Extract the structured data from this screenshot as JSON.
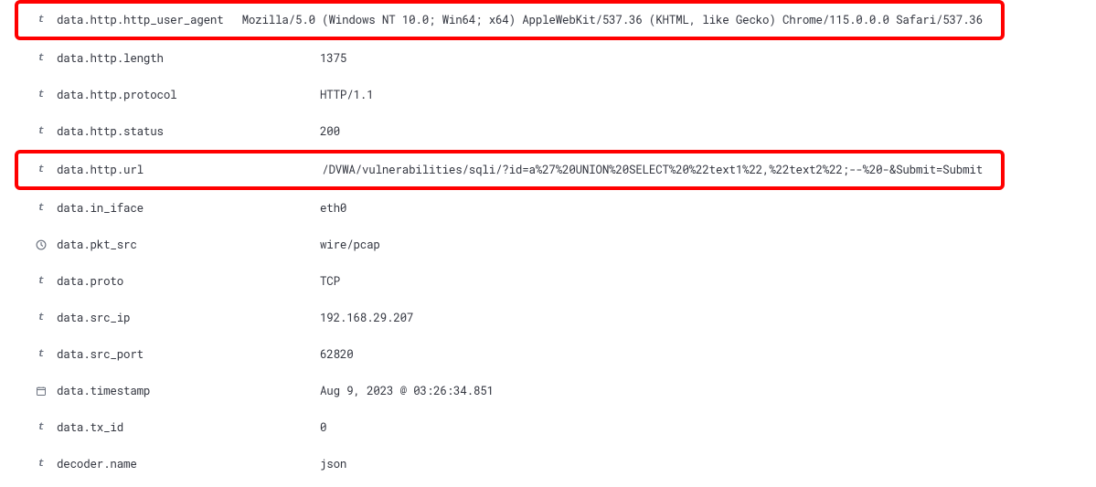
{
  "rows": [
    {
      "icon_type": "text",
      "name": "data.http.http_user_agent",
      "value": "Mozilla/5.0 (Windows NT 10.0; Win64; x64) AppleWebKit/537.36 (KHTML, like Gecko) Chrome/115.0.0.0 Safari/537.36",
      "highlighted": true
    },
    {
      "icon_type": "text",
      "name": "data.http.length",
      "value": "1375",
      "highlighted": false
    },
    {
      "icon_type": "text",
      "name": "data.http.protocol",
      "value": "HTTP/1.1",
      "highlighted": false
    },
    {
      "icon_type": "text",
      "name": "data.http.status",
      "value": "200",
      "highlighted": false
    },
    {
      "icon_type": "text",
      "name": "data.http.url",
      "value": "/DVWA/vulnerabilities/sqli/?id=a%27%20UNION%20SELECT%20%22text1%22,%22text2%22;--%20-&Submit=Submit",
      "highlighted": true
    },
    {
      "icon_type": "text",
      "name": "data.in_iface",
      "value": "eth0",
      "highlighted": false
    },
    {
      "icon_type": "clock",
      "name": "data.pkt_src",
      "value": "wire/pcap",
      "highlighted": false
    },
    {
      "icon_type": "text",
      "name": "data.proto",
      "value": "TCP",
      "highlighted": false
    },
    {
      "icon_type": "text",
      "name": "data.src_ip",
      "value": "192.168.29.207",
      "highlighted": false
    },
    {
      "icon_type": "text",
      "name": "data.src_port",
      "value": "62820",
      "highlighted": false
    },
    {
      "icon_type": "calendar",
      "name": "data.timestamp",
      "value": "Aug 9, 2023 @ 03:26:34.851",
      "highlighted": false
    },
    {
      "icon_type": "text",
      "name": "data.tx_id",
      "value": "0",
      "highlighted": false
    },
    {
      "icon_type": "text",
      "name": "decoder.name",
      "value": "json",
      "highlighted": false
    }
  ]
}
